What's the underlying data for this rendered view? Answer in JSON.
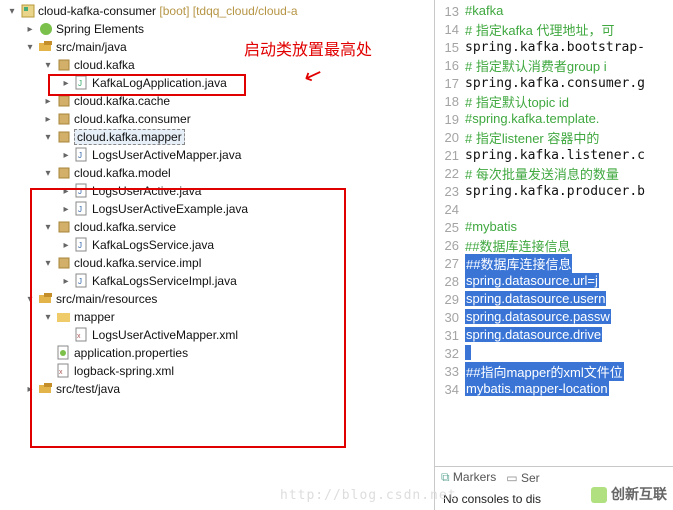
{
  "project": {
    "name": "cloud-kafka-consumer",
    "decor": "[boot] [tdqq_cloud/cloud-a"
  },
  "callout": "启动类放置最高处",
  "tree": {
    "springElements": "Spring Elements",
    "srcMainJava": "src/main/java",
    "pkg": {
      "kafka": "cloud.kafka",
      "kafkaApp": "KafkaLogApplication.java",
      "cache": "cloud.kafka.cache",
      "consumer": "cloud.kafka.consumer",
      "mapper": "cloud.kafka.mapper",
      "mapperFile": "LogsUserActiveMapper.java",
      "model": "cloud.kafka.model",
      "modelFile1": "LogsUserActive.java",
      "modelFile2": "LogsUserActiveExample.java",
      "service": "cloud.kafka.service",
      "serviceFile": "KafkaLogsService.java",
      "serviceImpl": "cloud.kafka.service.impl",
      "serviceImplFile": "KafkaLogsServiceImpl.java"
    },
    "srcMainRes": "src/main/resources",
    "mapperDir": "mapper",
    "mapperXml": "LogsUserActiveMapper.xml",
    "appProps": "application.properties",
    "logback": "logback-spring.xml",
    "srcTestJava": "src/test/java"
  },
  "editor_lines": [
    {
      "n": 13,
      "t": "#kafka",
      "cmt": true
    },
    {
      "n": 14,
      "t": "# 指定kafka 代理地址，可",
      "cmt": true
    },
    {
      "n": 15,
      "t": "spring.kafka.bootstrap-"
    },
    {
      "n": 16,
      "t": "# 指定默认消费者group i",
      "cmt": true
    },
    {
      "n": 17,
      "t": "spring.kafka.consumer.g"
    },
    {
      "n": 18,
      "t": "# 指定默认topic id",
      "cmt": true
    },
    {
      "n": 19,
      "t": "#spring.kafka.template.",
      "cmt": true
    },
    {
      "n": 20,
      "t": "# 指定listener 容器中的",
      "cmt": true
    },
    {
      "n": 21,
      "t": "spring.kafka.listener.c"
    },
    {
      "n": 22,
      "t": "# 每次批量发送消息的数量",
      "cmt": true
    },
    {
      "n": 23,
      "t": "spring.kafka.producer.b"
    },
    {
      "n": 24,
      "t": ""
    },
    {
      "n": 25,
      "t": "#mybatis",
      "cmt": true
    },
    {
      "n": 26,
      "t": "##数据库连接信息",
      "cmt": true
    },
    {
      "n": 27,
      "t": "##数据库连接信息",
      "hl": true
    },
    {
      "n": 28,
      "t": "spring.datasource.url=j",
      "hl": true
    },
    {
      "n": 29,
      "t": "spring.datasource.usern",
      "hl": true
    },
    {
      "n": 30,
      "t": "spring.datasource.passw",
      "hl": true
    },
    {
      "n": 31,
      "t": "spring.datasource.drive",
      "hl": true
    },
    {
      "n": 32,
      "t": "",
      "hl_empty": true
    },
    {
      "n": 33,
      "t": "##指向mapper的xml文件位",
      "hl": true
    },
    {
      "n": 34,
      "t": "mybatis.mapper-location",
      "hl": true
    }
  ],
  "tabs": {
    "markers": "Markers",
    "servers": "Ser"
  },
  "console": "No consoles to dis",
  "watermark": "http://blog.csdn.net",
  "brand": "创新互联"
}
